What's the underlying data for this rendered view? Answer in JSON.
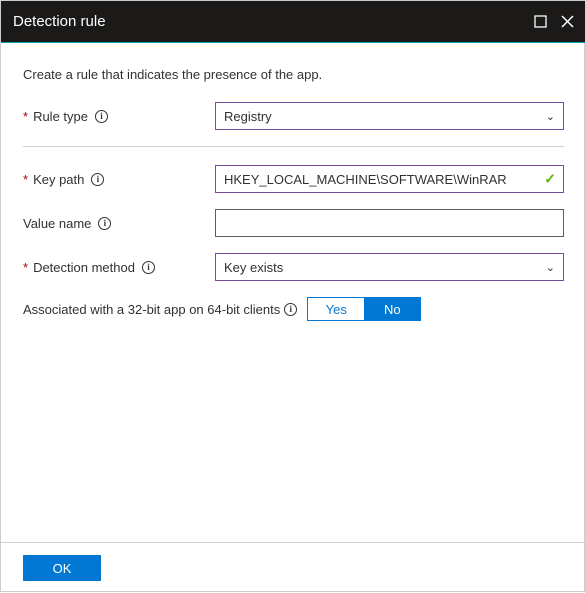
{
  "title": "Detection rule",
  "description": "Create a rule that indicates the presence of the app.",
  "labels": {
    "rule_type": "Rule type",
    "key_path": "Key path",
    "value_name": "Value name",
    "detection_method": "Detection method",
    "associated": "Associated with a 32-bit app on 64-bit clients"
  },
  "fields": {
    "rule_type": "Registry",
    "key_path": "HKEY_LOCAL_MACHINE\\SOFTWARE\\WinRAR",
    "value_name": "",
    "detection_method": "Key exists"
  },
  "toggle": {
    "yes": "Yes",
    "no": "No",
    "selected": "No"
  },
  "buttons": {
    "ok": "OK"
  }
}
